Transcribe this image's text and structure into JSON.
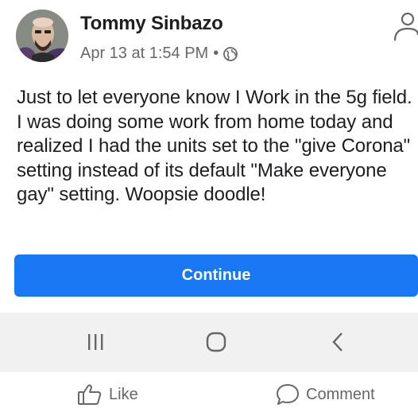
{
  "post": {
    "author": "Tommy Sinbazo",
    "timestamp": "Apr 13 at 1:54 PM",
    "separator": "•",
    "audience_icon": "globe-icon",
    "text": "Just to let everyone know I Work in the 5g field. I was doing some work from home today and realized I had the units set to the \"give Corona\" setting instead of its default \"Make everyone gay\" setting. Woopsie doodle!"
  },
  "continue_button": {
    "label": "Continue",
    "color": "#1877f2"
  },
  "system_nav": {
    "icons": [
      "recent-apps-icon",
      "home-icon",
      "back-icon"
    ]
  },
  "actions": {
    "like_label": "Like",
    "comment_label": "Comment"
  },
  "colors": {
    "meta_text": "#65676b",
    "nav_background": "#f1f1f1"
  }
}
